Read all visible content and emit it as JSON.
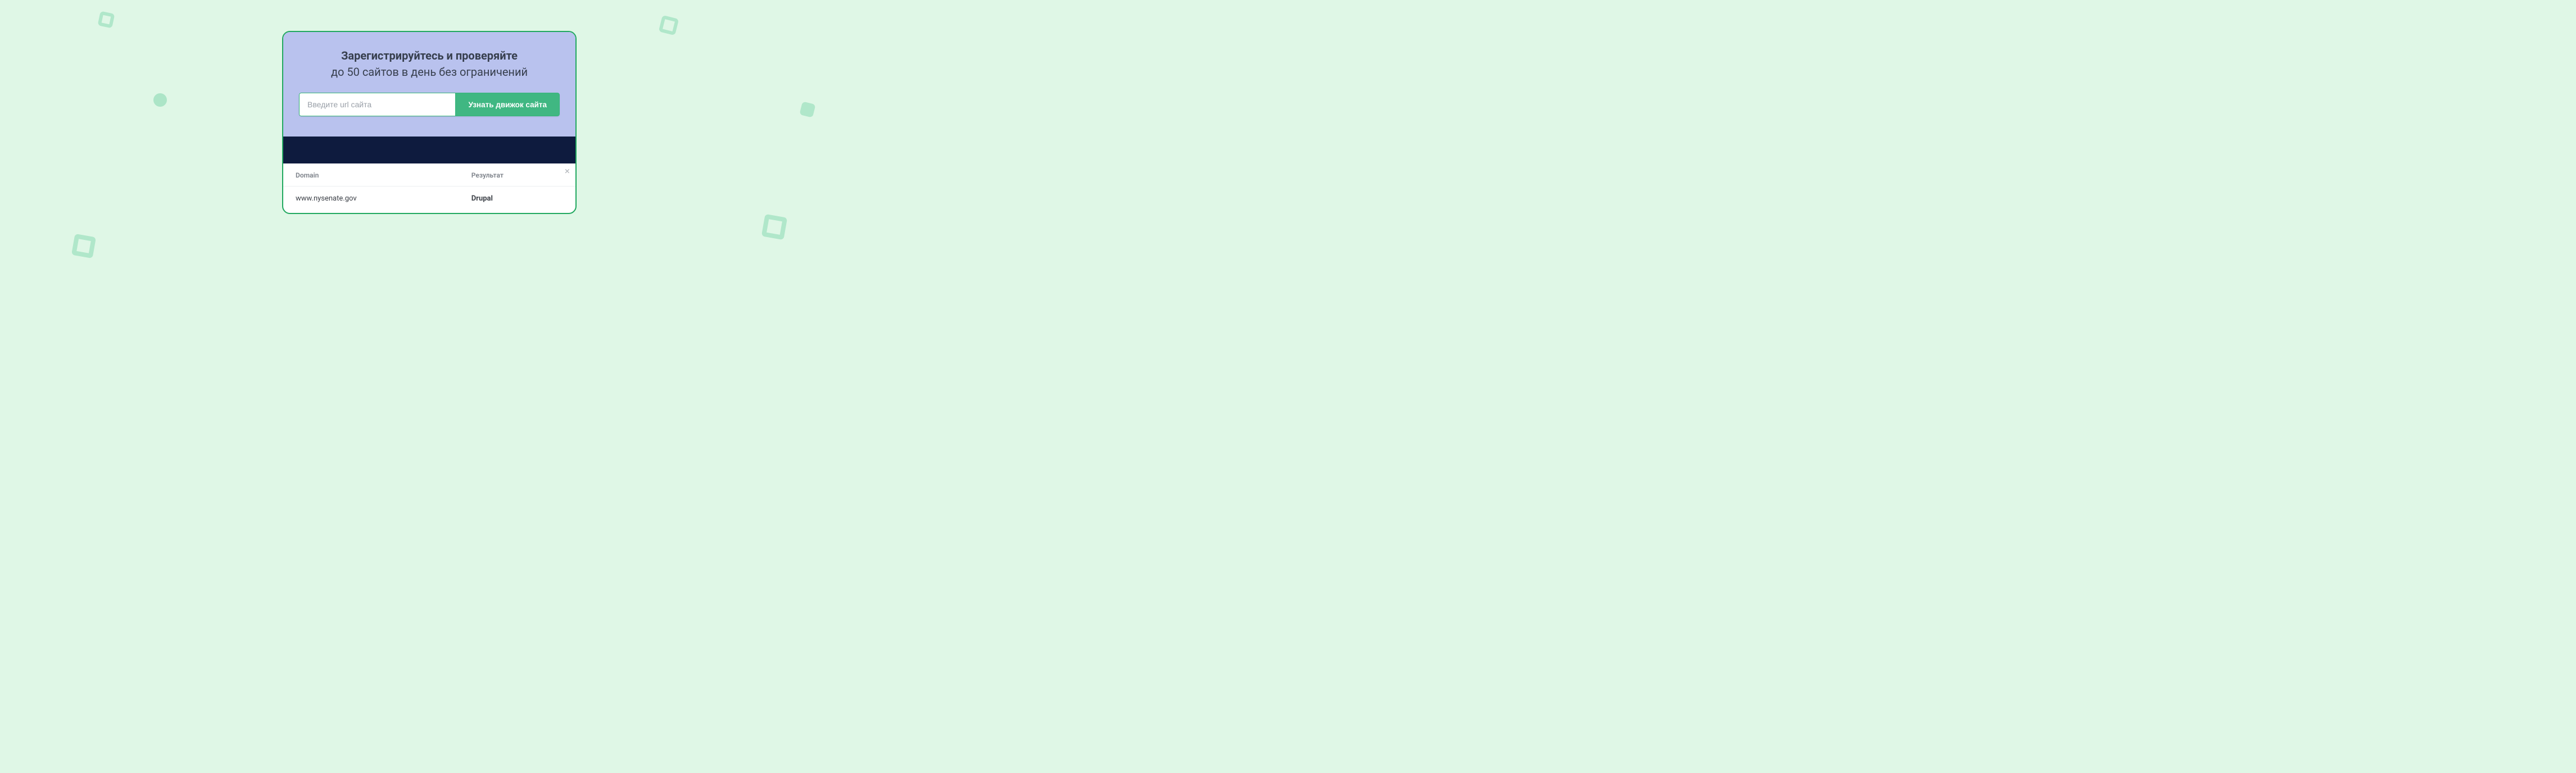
{
  "headline": {
    "bold": "Зарегистрируйтесь и проверяйте",
    "sub": "до 50 сайтов в день без ограничений"
  },
  "input": {
    "placeholder": "Введите url сайта",
    "value": ""
  },
  "button": {
    "label": "Узнать движок сайта"
  },
  "results": {
    "headers": {
      "domain": "Domain",
      "result": "Результат"
    },
    "rows": [
      {
        "domain": "www.nysenate.gov",
        "result": "Drupal"
      }
    ]
  },
  "colors": {
    "accent": "#21a85f",
    "button": "#40b782",
    "panel": "#b9c2ee",
    "band": "#0e1b3e",
    "bg": "#dff7e6"
  }
}
